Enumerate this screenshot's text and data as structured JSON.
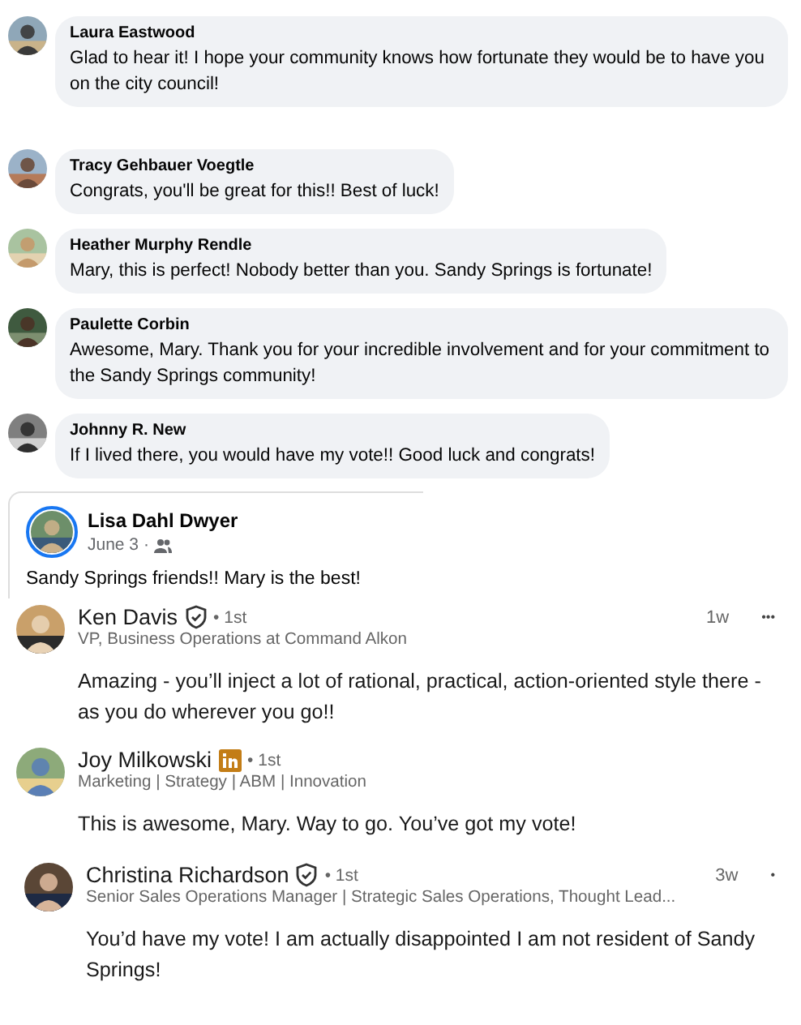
{
  "facebook_comments": [
    {
      "author": "Laura Eastwood",
      "text": "Glad to hear it! I hope your community knows how fortunate they would be to have you on the city council!"
    },
    {
      "author": "Tracy Gehbauer Voegtle",
      "text": "Congrats, you'll be great for this!! Best of luck!"
    },
    {
      "author": "Heather Murphy Rendle",
      "text": "Mary, this is perfect! Nobody better than you. Sandy Springs is fortunate!"
    },
    {
      "author": "Paulette Corbin",
      "text": "Awesome, Mary. Thank you for your incredible involvement and for your commitment to the Sandy Springs community!"
    },
    {
      "author": "Johnny R. New",
      "text": "If I lived there, you would have my vote!! Good luck and congrats!"
    }
  ],
  "facebook_post": {
    "author": "Lisa Dahl Dwyer",
    "date": "June 3 ·",
    "text": "Sandy Springs friends!!  Mary is the best!"
  },
  "linkedin_comments": [
    {
      "author": "Ken Davis",
      "kind": "verified",
      "degree": "• 1st",
      "headline": "VP, Business Operations at Command Alkon",
      "time": "1w",
      "more": "•••",
      "text": "Amazing - you’ll inject a lot of rational, practical, action-oriented style there - as you do wherever you go!!"
    },
    {
      "author": "Joy Milkowski",
      "kind": "linkedin",
      "degree": "• 1st",
      "headline": "Marketing | Strategy | ABM | Innovation",
      "text": "This is awesome, Mary. Way to go. You’ve got my vote!"
    },
    {
      "author": "Christina Richardson",
      "kind": "verified",
      "degree": "• 1st",
      "headline": "Senior Sales Operations Manager | Strategic Sales Operations, Thought Lead...",
      "time": "3w",
      "more": "•",
      "text": "You’d have my vote! I am actually disappointed I am not resident of Sandy Springs!"
    }
  ]
}
